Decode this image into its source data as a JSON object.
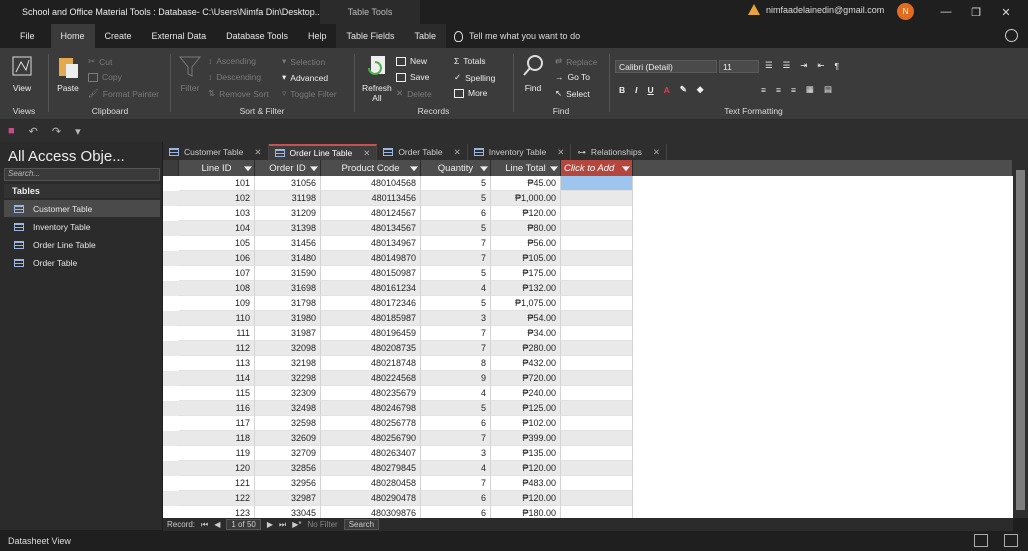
{
  "titlebar": {
    "app_title": "School and Office Material Tools : Database- C:\\Users\\Nimfa Din\\Desktop...",
    "context_title": "Table Tools",
    "email": "nimfaadelainedin@gmail.com",
    "avatar_initial": "N"
  },
  "ribbon_tabs": [
    "File",
    "Home",
    "Create",
    "External Data",
    "Database Tools",
    "Help",
    "Table Fields",
    "Table"
  ],
  "tell_me": "Tell me what you want to do",
  "ribbon": {
    "views": {
      "view": "View",
      "label": "Views"
    },
    "clipboard": {
      "paste": "Paste",
      "cut": "Cut",
      "copy": "Copy",
      "format_painter": "Format Painter",
      "label": "Clipboard"
    },
    "sort_filter": {
      "filter": "Filter",
      "ascending": "Ascending",
      "descending": "Descending",
      "remove_sort": "Remove Sort",
      "selection": "Selection",
      "advanced": "Advanced",
      "toggle_filter": "Toggle Filter",
      "label": "Sort & Filter"
    },
    "records": {
      "refresh": "Refresh",
      "refresh_all": "All",
      "new": "New",
      "save": "Save",
      "delete": "Delete",
      "totals": "Totals",
      "spelling": "Spelling",
      "more": "More",
      "label": "Records"
    },
    "find": {
      "find": "Find",
      "replace": "Replace",
      "goto": "Go To",
      "select": "Select",
      "label": "Find"
    },
    "text_formatting": {
      "font": "Calibri (Detail)",
      "size": "11",
      "label": "Text Formatting"
    }
  },
  "nav": {
    "title": "All Access Obje...",
    "search_placeholder": "Search...",
    "section": "Tables",
    "items": [
      "Customer Table",
      "Inventory Table",
      "Order Line Table",
      "Order Table"
    ]
  },
  "doc_tabs": [
    "Customer Table",
    "Order Line Table",
    "Order Table",
    "Inventory Table",
    "Relationships"
  ],
  "table": {
    "columns": [
      "Line ID",
      "Order ID",
      "Product Code",
      "Quantity",
      "Line Total",
      "Click to Add"
    ],
    "rows": [
      [
        "101",
        "31056",
        "480104568",
        "5",
        "₱45.00"
      ],
      [
        "102",
        "31198",
        "480113456",
        "5",
        "₱1,000.00"
      ],
      [
        "103",
        "31209",
        "480124567",
        "6",
        "₱120.00"
      ],
      [
        "104",
        "31398",
        "480134567",
        "5",
        "₱80.00"
      ],
      [
        "105",
        "31456",
        "480134967",
        "7",
        "₱56.00"
      ],
      [
        "106",
        "31480",
        "480149870",
        "7",
        "₱105.00"
      ],
      [
        "107",
        "31590",
        "480150987",
        "5",
        "₱175.00"
      ],
      [
        "108",
        "31698",
        "480161234",
        "4",
        "₱132.00"
      ],
      [
        "109",
        "31798",
        "480172346",
        "5",
        "₱1,075.00"
      ],
      [
        "110",
        "31980",
        "480185987",
        "3",
        "₱54.00"
      ],
      [
        "111",
        "31987",
        "480196459",
        "7",
        "₱34.00"
      ],
      [
        "112",
        "32098",
        "480208735",
        "7",
        "₱280.00"
      ],
      [
        "113",
        "32198",
        "480218748",
        "8",
        "₱432.00"
      ],
      [
        "114",
        "32298",
        "480224568",
        "9",
        "₱720.00"
      ],
      [
        "115",
        "32309",
        "480235679",
        "4",
        "₱240.00"
      ],
      [
        "116",
        "32498",
        "480246798",
        "5",
        "₱125.00"
      ],
      [
        "117",
        "32598",
        "480256778",
        "6",
        "₱102.00"
      ],
      [
        "118",
        "32609",
        "480256790",
        "7",
        "₱399.00"
      ],
      [
        "119",
        "32709",
        "480263407",
        "3",
        "₱135.00"
      ],
      [
        "120",
        "32856",
        "480279845",
        "4",
        "₱120.00"
      ],
      [
        "121",
        "32956",
        "480280458",
        "7",
        "₱483.00"
      ],
      [
        "122",
        "32987",
        "480290478",
        "6",
        "₱120.00"
      ],
      [
        "123",
        "33045",
        "480309876",
        "6",
        "₱180.00"
      ]
    ]
  },
  "record_nav": {
    "label": "Record:",
    "position": "1 of 50",
    "filter": "No Filter",
    "search": "Search"
  },
  "status": "Datasheet View",
  "colors": {
    "accent": "#b3473e",
    "avatar": "#e36b1e",
    "selected_cell": "#9ec5ee"
  }
}
